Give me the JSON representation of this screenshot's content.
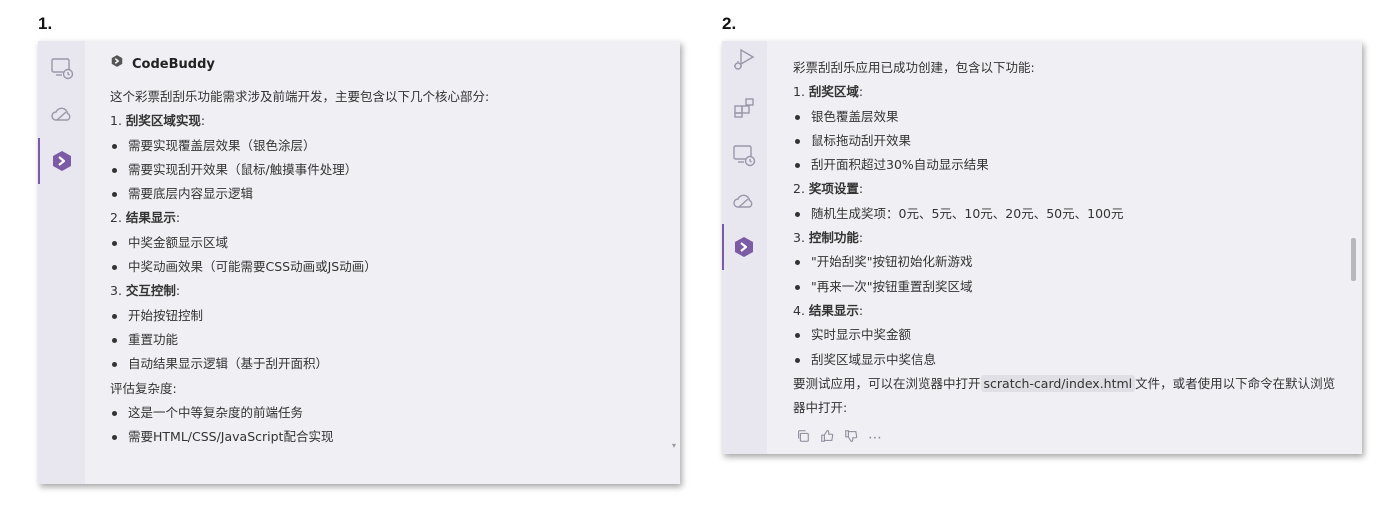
{
  "labels": {
    "panel1": "1.",
    "panel2": "2."
  },
  "panel1": {
    "header_title": "CodeBuddy",
    "lines": [
      {
        "text": "这个彩票刮刮乐功能需求涉及前端开发，主要包含以下几个核心部分:",
        "kind": "text"
      },
      {
        "num": "1. ",
        "strong": "刮奖区域实现",
        "colon": ":",
        "kind": "heading"
      },
      {
        "text": "需要实现覆盖层效果（银色涂层）",
        "kind": "bullet"
      },
      {
        "text": "需要实现刮开效果（鼠标/触摸事件处理）",
        "kind": "bullet"
      },
      {
        "text": "需要底层内容显示逻辑",
        "kind": "bullet"
      },
      {
        "num": "2. ",
        "strong": "结果显示",
        "colon": ":",
        "kind": "heading"
      },
      {
        "text": "中奖金额显示区域",
        "kind": "bullet"
      },
      {
        "text": "中奖动画效果（可能需要CSS动画或JS动画）",
        "kind": "bullet"
      },
      {
        "num": "3. ",
        "strong": "交互控制",
        "colon": ":",
        "kind": "heading"
      },
      {
        "text": "开始按钮控制",
        "kind": "bullet"
      },
      {
        "text": "重置功能",
        "kind": "bullet"
      },
      {
        "text": "自动结果显示逻辑（基于刮开面积）",
        "kind": "bullet"
      },
      {
        "text": "评估复杂度:",
        "kind": "text"
      },
      {
        "text": "这是一个中等复杂度的前端任务",
        "kind": "bullet"
      },
      {
        "text": "需要HTML/CSS/JavaScript配合实现",
        "kind": "bullet"
      }
    ]
  },
  "panel2": {
    "lines": [
      {
        "text": "彩票刮刮乐应用已成功创建，包含以下功能:",
        "kind": "text"
      },
      {
        "num": "1. ",
        "strong": "刮奖区域",
        "colon": ":",
        "kind": "heading"
      },
      {
        "text": "银色覆盖层效果",
        "kind": "bullet"
      },
      {
        "text": "鼠标拖动刮开效果",
        "kind": "bullet"
      },
      {
        "text": "刮开面积超过30%自动显示结果",
        "kind": "bullet"
      },
      {
        "num": "2. ",
        "strong": "奖项设置",
        "colon": ":",
        "kind": "heading"
      },
      {
        "text": "随机生成奖项：0元、5元、10元、20元、50元、100元",
        "kind": "bullet"
      },
      {
        "num": "3. ",
        "strong": "控制功能",
        "colon": ":",
        "kind": "heading"
      },
      {
        "text": "\"开始刮奖\"按钮初始化新游戏",
        "kind": "bullet"
      },
      {
        "text": "\"再来一次\"按钮重置刮奖区域",
        "kind": "bullet"
      },
      {
        "num": "4. ",
        "strong": "结果显示",
        "colon": ":",
        "kind": "heading"
      },
      {
        "text": "实时显示中奖金额",
        "kind": "bullet"
      },
      {
        "text": "刮奖区域显示中奖信息",
        "kind": "bullet"
      }
    ],
    "final_before": "要测试应用，可以在浏览器中打开",
    "final_code": "scratch-card/index.html",
    "final_after": "文件，或者使用以下命令在默认浏览器中打开:"
  },
  "colors": {
    "accent": "#7b5aa6",
    "window_bg": "#f0eff4",
    "sidebar_bg": "#e8e6ef",
    "text": "#333333"
  },
  "icons": {
    "panel1_sidebar": [
      "chat-history-icon",
      "cloud-icon",
      "codebuddy-logo-icon"
    ],
    "panel2_sidebar": [
      "run-debug-icon",
      "extensions-icon",
      "chat-history-icon",
      "cloud-icon",
      "codebuddy-logo-icon"
    ],
    "actions": [
      "copy-icon",
      "thumbs-up-icon",
      "thumbs-down-icon",
      "more-icon"
    ]
  }
}
